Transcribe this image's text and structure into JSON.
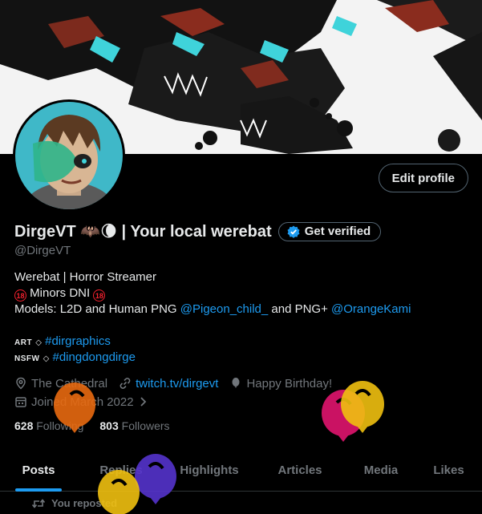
{
  "profile": {
    "display_name": "DirgeVT 🦇🌘 | Your local werebat",
    "handle": "@DirgeVT",
    "edit_profile_label": "Edit profile",
    "get_verified_label": "Get verified"
  },
  "bio": {
    "line1": "Werebat |  Horror Streamer",
    "line2": "Minors DNI",
    "line3_prefix": "Models: L2D and Human PNG ",
    "line3_link1": "@Pigeon_child_",
    "line3_mid": " and PNG+ ",
    "line3_link2": "@OrangeKami",
    "art_label": "ART",
    "art_tag": "#dirgraphics",
    "nsfw_label": "NSFW",
    "nsfw_tag": "#dingdongdirge",
    "badge18": "18"
  },
  "meta": {
    "location": "The Cathedral",
    "website": "twitch.tv/dirgevt",
    "birthday": "Happy Birthday!",
    "joined": "Joined March 2022"
  },
  "stats": {
    "following_count": "628",
    "following_label": "Following",
    "followers_count": "803",
    "followers_label": "Followers"
  },
  "tabs": [
    {
      "label": "Posts"
    },
    {
      "label": "Replies"
    },
    {
      "label": "Highlights"
    },
    {
      "label": "Articles"
    },
    {
      "label": "Media"
    },
    {
      "label": "Likes"
    }
  ],
  "timeline": {
    "repost_label": "You reposted"
  },
  "colors": {
    "accent": "#1d9bf0",
    "background": "#000000",
    "text": "#e7e9ea",
    "muted": "#71767b"
  }
}
